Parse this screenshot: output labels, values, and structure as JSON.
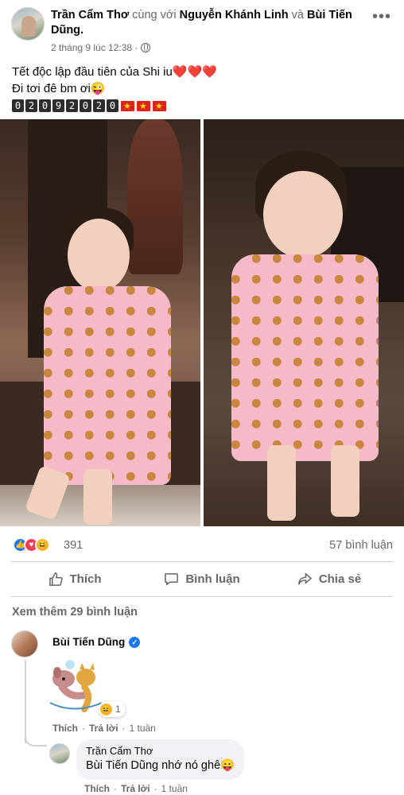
{
  "post": {
    "author": "Trần Cẩm Thơ",
    "with_word": "cùng với",
    "tagged_1": "Nguyễn Khánh Linh",
    "and_word": "và",
    "tagged_2": "Bùi Tiến Dũng.",
    "timestamp": "2 tháng 9 lúc 12:38 ·",
    "more_icon": "more-icon",
    "caption_line_1": "Tết độc lập đầu tiên của Shi iu",
    "caption_line_1_emoji": "❤️❤️❤️",
    "caption_line_2": "Đi tơi đê bm ơi😜",
    "date_digits": [
      "0",
      "2",
      "0",
      "9",
      "2",
      "0",
      "2",
      "0"
    ]
  },
  "reactions": {
    "count": "391",
    "comments": "57 bình luận",
    "colors": {
      "like": "#1877f2",
      "love": "#f33e58",
      "haha": "#f7b125"
    }
  },
  "actions": {
    "like": "Thích",
    "comment": "Bình luận",
    "share": "Chia sẻ"
  },
  "comments": {
    "view_more": "Xem thêm 29 bình luận",
    "items": [
      {
        "author": "Bùi Tiến Dũng",
        "verified": true,
        "sticker_reaction_count": "1",
        "like": "Thích",
        "reply": "Trả lời",
        "time": "1 tuần"
      },
      {
        "author": "Trần Cẩm Thơ",
        "text": "Bùi Tiến Dũng nhớ nó ghê😛",
        "like": "Thích",
        "reply": "Trả lời",
        "time": "1 tuần"
      }
    ]
  }
}
